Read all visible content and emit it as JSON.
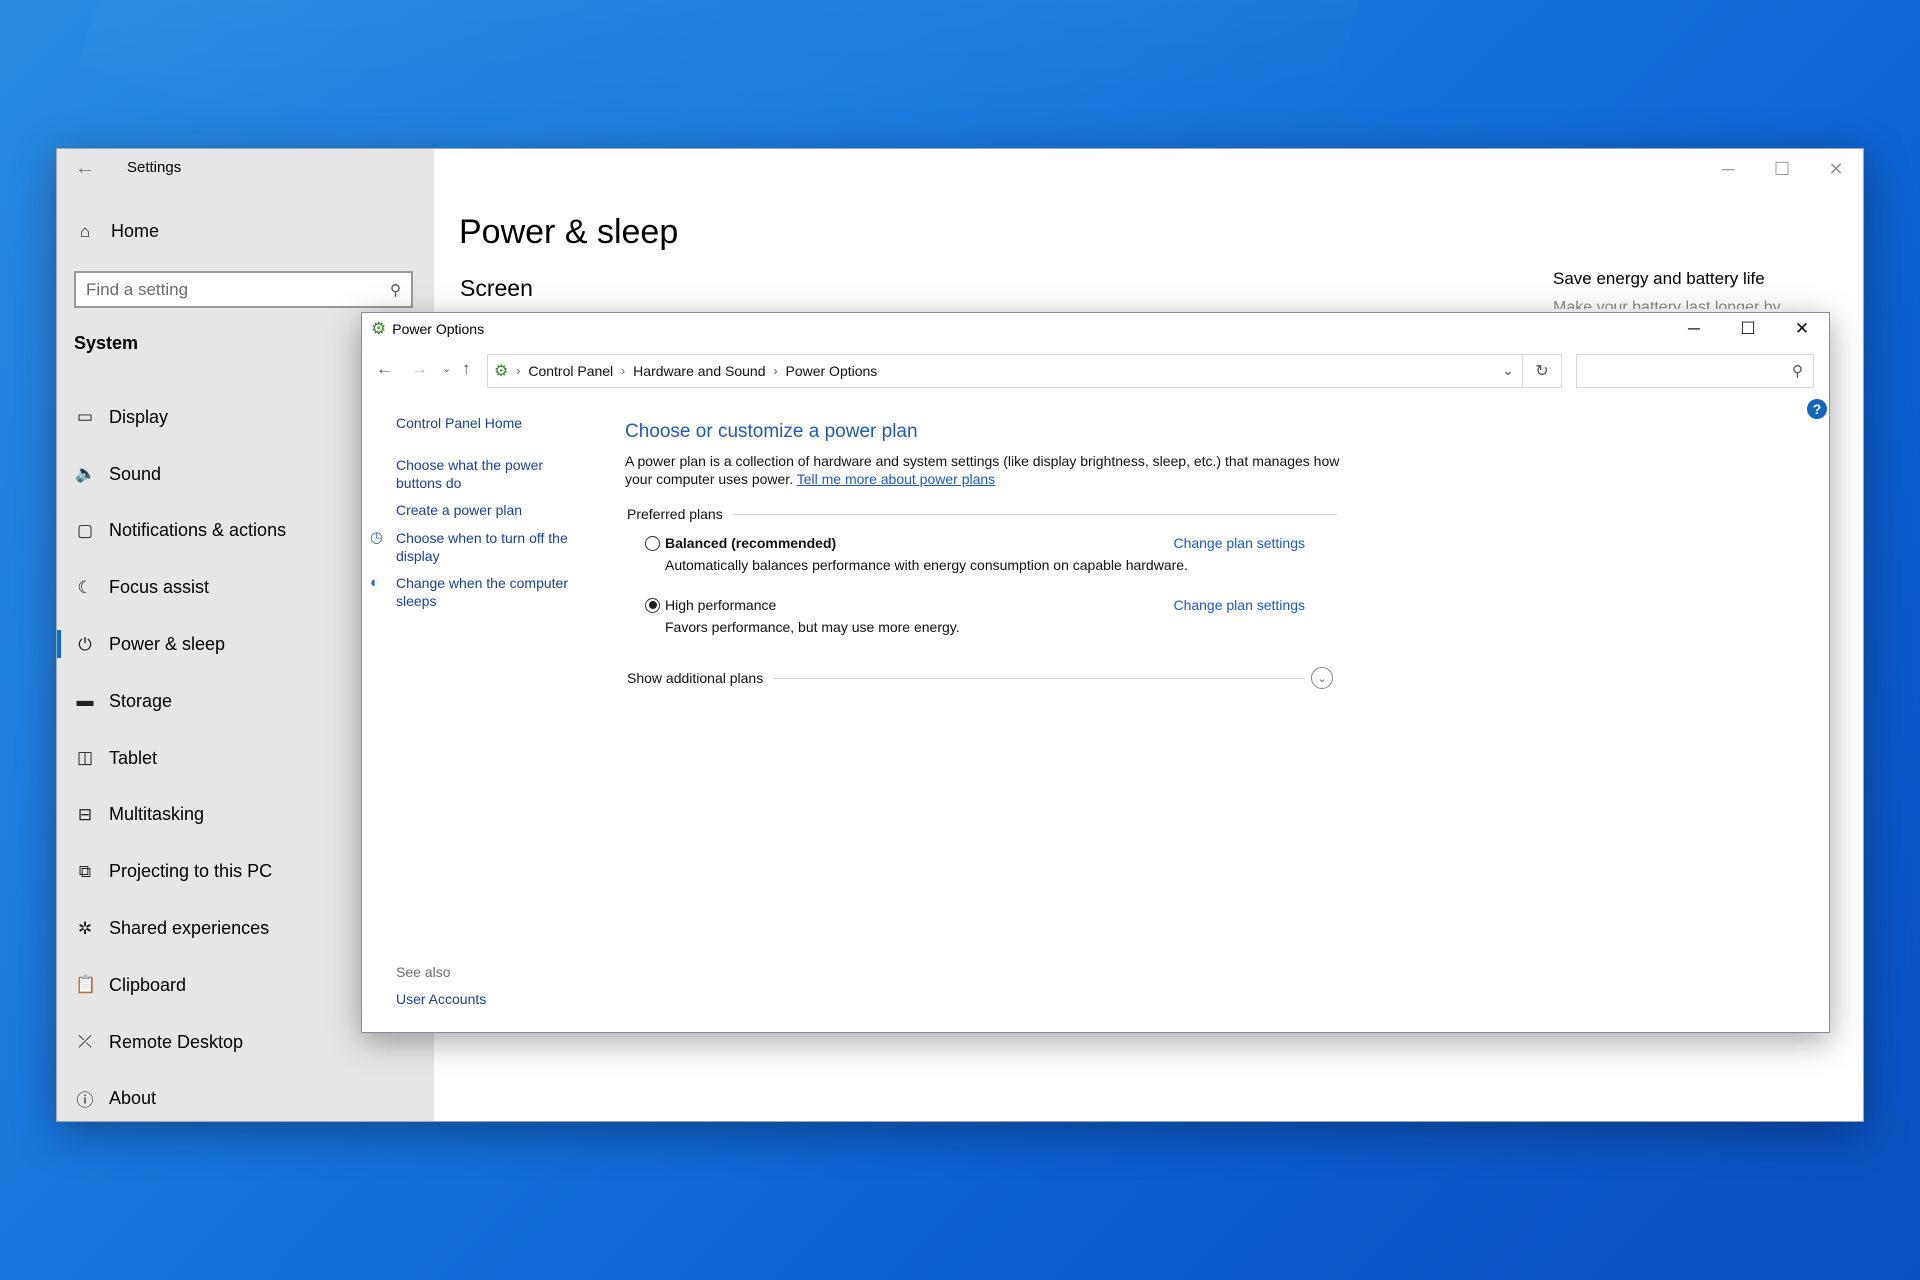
{
  "settings": {
    "title": "Settings",
    "home_label": "Home",
    "search_placeholder": "Find a setting",
    "section_title": "System",
    "nav": [
      {
        "label": "Display",
        "icon": "monitor-icon"
      },
      {
        "label": "Sound",
        "icon": "speaker-icon"
      },
      {
        "label": "Notifications & actions",
        "icon": "notification-icon"
      },
      {
        "label": "Focus assist",
        "icon": "moon-icon"
      },
      {
        "label": "Power & sleep",
        "icon": "power-icon",
        "active": true
      },
      {
        "label": "Storage",
        "icon": "storage-icon"
      },
      {
        "label": "Tablet",
        "icon": "tablet-icon"
      },
      {
        "label": "Multitasking",
        "icon": "multitasking-icon"
      },
      {
        "label": "Projecting to this PC",
        "icon": "projecting-icon"
      },
      {
        "label": "Shared experiences",
        "icon": "shared-icon"
      },
      {
        "label": "Clipboard",
        "icon": "clipboard-icon"
      },
      {
        "label": "Remote Desktop",
        "icon": "remote-desktop-icon"
      },
      {
        "label": "About",
        "icon": "info-icon"
      }
    ],
    "page_title": "Power & sleep",
    "screen_heading": "Screen",
    "side_heading": "Save energy and battery life",
    "side_sub": "Make your battery last longer by"
  },
  "power": {
    "title": "Power Options",
    "breadcrumb": [
      "Control Panel",
      "Hardware and Sound",
      "Power Options"
    ],
    "search_value": "",
    "left_links": {
      "home": "Control Panel Home",
      "buttons": [
        "Choose what the power",
        "buttons do"
      ],
      "create": "Create a power plan",
      "display": [
        "Choose when to turn off the",
        "display"
      ],
      "sleep": [
        "Change when the computer",
        "sleeps"
      ]
    },
    "see_also": "See also",
    "user_accounts": "User Accounts",
    "heading": "Choose or customize a power plan",
    "description": "A power plan is a collection of hardware and system settings (like display brightness, sleep, etc.) that manages how your computer uses power.",
    "learn_more": "Tell me more about power plans",
    "preferred_label": "Preferred plans",
    "plans": [
      {
        "name": "Balanced (recommended)",
        "desc": "Automatically balances performance with energy consumption on capable hardware.",
        "link": "Change plan settings",
        "selected": false
      },
      {
        "name": "High performance",
        "desc": "Favors performance, but may use more energy.",
        "link": "Change plan settings",
        "selected": true
      }
    ],
    "show_more": "Show additional plans"
  },
  "colors": {
    "accent": "#0a6cd6",
    "link": "#1a56d6",
    "heading_blue": "#1e5bb5"
  }
}
